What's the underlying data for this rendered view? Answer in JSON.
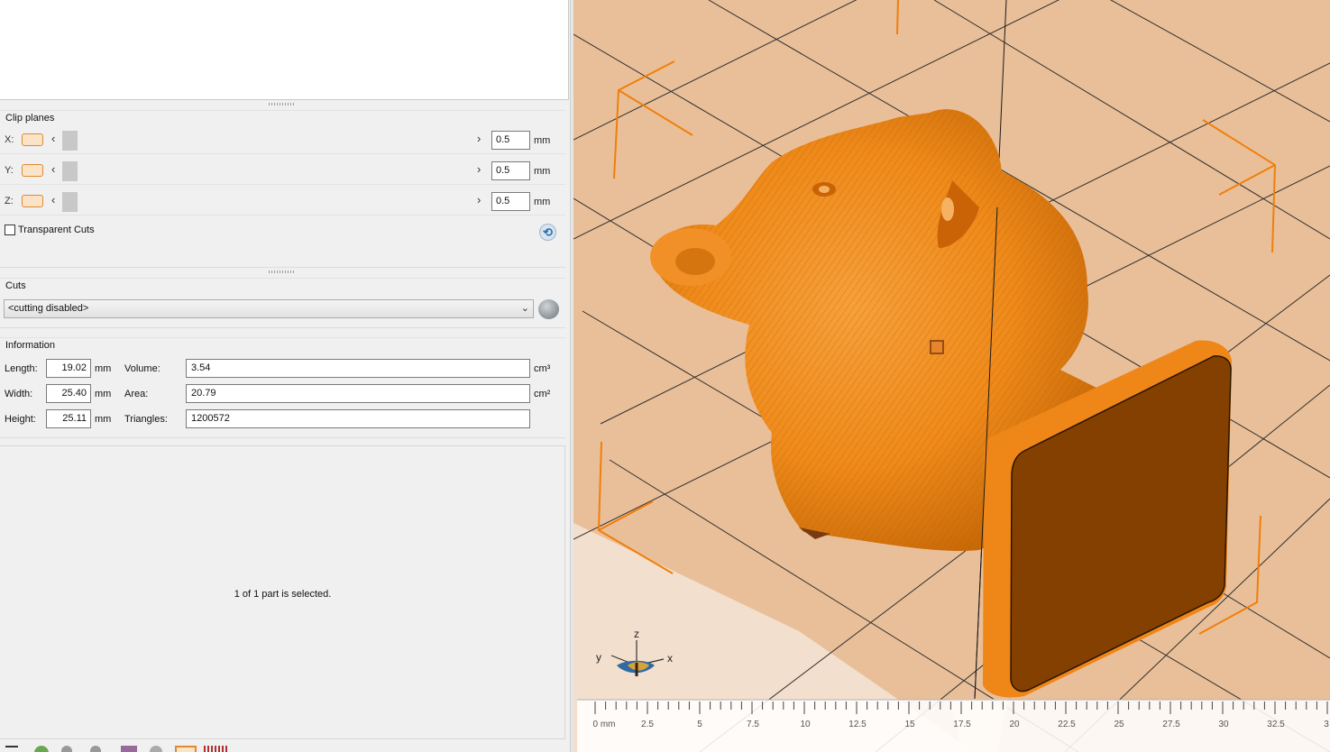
{
  "clip_planes": {
    "title": "Clip planes",
    "rows": [
      {
        "axis": "X:",
        "value": "0.5",
        "unit": "mm"
      },
      {
        "axis": "Y:",
        "value": "0.5",
        "unit": "mm"
      },
      {
        "axis": "Z:",
        "value": "0.5",
        "unit": "mm"
      }
    ],
    "transparent_cuts_label": "Transparent Cuts",
    "transparent_cuts_checked": false
  },
  "cuts": {
    "title": "Cuts",
    "selected": "<cutting disabled>"
  },
  "information": {
    "title": "Information",
    "length_label": "Length:",
    "length_value": "19.02",
    "width_label": "Width:",
    "width_value": "25.40",
    "height_label": "Height:",
    "height_value": "25.11",
    "dim_unit": "mm",
    "volume_label": "Volume:",
    "volume_value": "3.54",
    "volume_unit": "cm³",
    "area_label": "Area:",
    "area_value": "20.79",
    "area_unit": "cm²",
    "triangles_label": "Triangles:",
    "triangles_value": "1200572"
  },
  "selection_status": "1 of 1 part is selected.",
  "viewport": {
    "axes": {
      "x": "x",
      "y": "y",
      "z": "z"
    },
    "ruler_labels": [
      "0 mm",
      "2.5",
      "5",
      "7.5",
      "10",
      "12.5",
      "15",
      "17.5",
      "20",
      "22.5",
      "25",
      "27.5",
      "30",
      "32.5",
      "3"
    ],
    "colors": {
      "background": "#e8bd97",
      "model": "#f08a14",
      "plate_face": "#844000",
      "grid": "#2a2a2a",
      "bounding_box": "#f0820a"
    }
  }
}
